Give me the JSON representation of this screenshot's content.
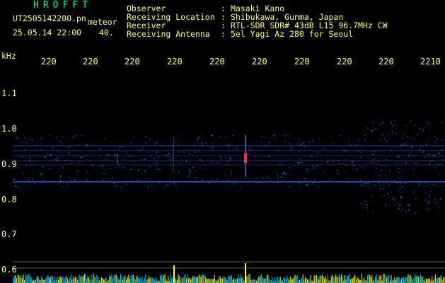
{
  "header": {
    "title": "HROFFT",
    "file_name": "UT2505142200.pn",
    "mode_label": "meteor",
    "datetime": "25.05.14 22:00",
    "count": "40."
  },
  "info": [
    {
      "label": "Observer",
      "colon": ":",
      "value": "Masaki Kano"
    },
    {
      "label": "Receiving Location",
      "colon": ":",
      "value": "Shibukawa, Gunma, Japan"
    },
    {
      "label": "Receiver",
      "colon": ":",
      "value": "RTL-SDR SDR# 43dB L15 96.7MHz CW"
    },
    {
      "label": "Receiving Antenna",
      "colon": ":",
      "value": "5el Yagi Az 280 for Seoul"
    }
  ],
  "axis": {
    "unit_label": "kHz",
    "x_ticks": [
      "220",
      "220",
      "220",
      "220",
      "220",
      "220",
      "220",
      "220",
      "220",
      "2210"
    ],
    "y_ticks": [
      "1.1",
      "1.0",
      "0.9",
      "0.8",
      "0.7",
      "0.6"
    ]
  },
  "colors": {
    "background": "#000000",
    "text": "#ffff66",
    "title": "#00ff66",
    "signal": "#3366ff",
    "meteor_hot": "#ff3333",
    "baseline": "#ffff00",
    "baseline_alt": "#00ccff",
    "gridline": "#aaaaaa"
  }
}
